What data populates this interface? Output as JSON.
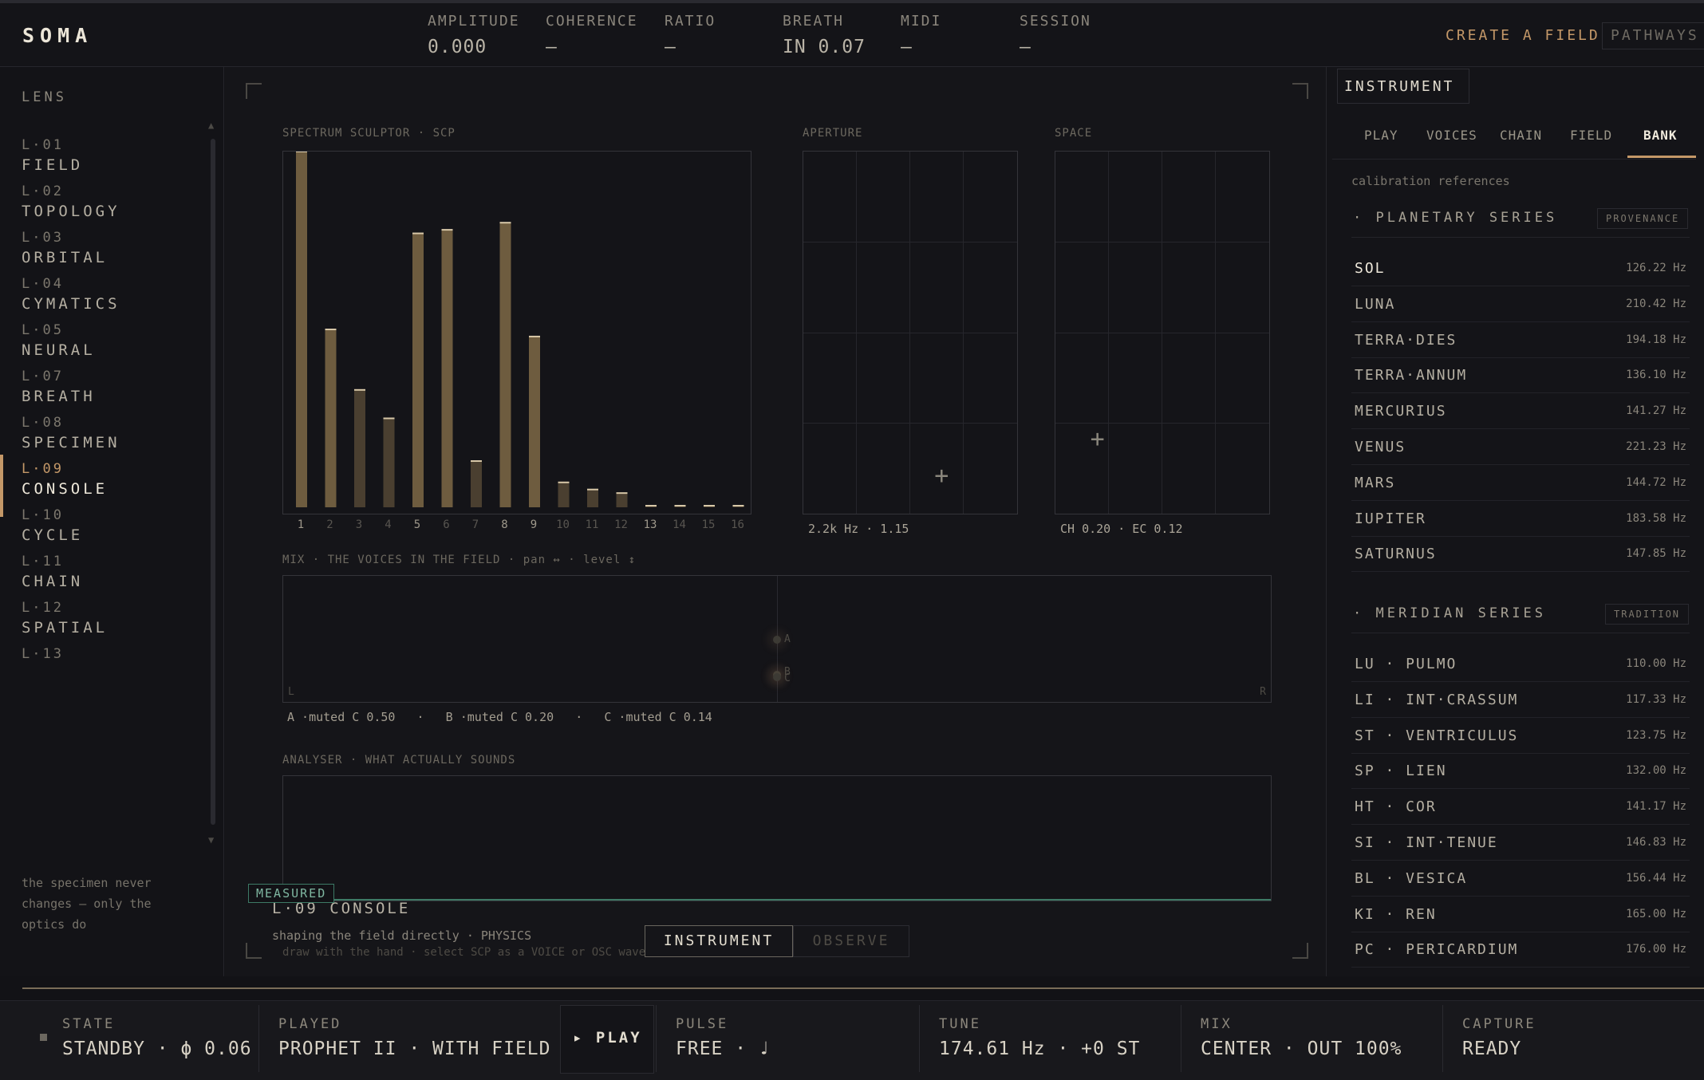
{
  "app": {
    "logo": "SOMA",
    "metrics": [
      {
        "label": "AMPLITUDE",
        "value": "0.000"
      },
      {
        "label": "COHERENCE",
        "value": "—"
      },
      {
        "label": "RATIO",
        "value": "—"
      },
      {
        "label": "BREATH",
        "value": "IN 0.07"
      },
      {
        "label": "MIDI",
        "value": "—"
      },
      {
        "label": "SESSION",
        "value": "—"
      }
    ],
    "create_field": "CREATE A FIELD",
    "pathways": "PATHWAYS"
  },
  "sidebar": {
    "title": "LENS",
    "items": [
      {
        "num": "L·01",
        "name": "FIELD"
      },
      {
        "num": "L·02",
        "name": "TOPOLOGY"
      },
      {
        "num": "L·03",
        "name": "ORBITAL"
      },
      {
        "num": "L·04",
        "name": "CYMATICS"
      },
      {
        "num": "L·05",
        "name": "NEURAL"
      },
      {
        "num": "L·07",
        "name": "BREATH"
      },
      {
        "num": "L·08",
        "name": "SPECIMEN"
      },
      {
        "num": "L·09",
        "name": "CONSOLE"
      },
      {
        "num": "L·10",
        "name": "CYCLE"
      },
      {
        "num": "L·11",
        "name": "CHAIN"
      },
      {
        "num": "L·12",
        "name": "SPATIAL"
      },
      {
        "num": "L·13",
        "name": ""
      }
    ],
    "active_index": 7,
    "note": "the specimen never changes — only the optics do"
  },
  "stage": {
    "spectrum_label": "SPECTRUM SCULPTOR · SCP",
    "aperture_label": "APERTURE",
    "space_label": "SPACE",
    "aperture_readout": "2.2k Hz · 1.15",
    "space_readout": "CH 0.20 · EC 0.12",
    "mix_label": "MIX · THE VOICES IN THE FIELD · pan ↔ · level ↕",
    "mix_axis_left": "L",
    "mix_axis_right": "R",
    "mix_voices": [
      "A",
      "B",
      "C"
    ],
    "mix_legend": "A ·muted C 0.50   ·   B ·muted C 0.20   ·   C ·muted C 0.14",
    "analyser_label": "ANALYSER · WHAT ACTUALLY SOUNDS",
    "measured_badge": "MEASURED",
    "title": "L·09  CONSOLE",
    "subtitle": "shaping the field directly · PHYSICS",
    "hint": "draw with the hand · select SCP as a VOICE or OSC waveform to hear it",
    "btn_instrument": "INSTRUMENT",
    "btn_observe": "OBSERVE"
  },
  "chart_data": [
    {
      "type": "bar",
      "title": "SPECTRUM SCULPTOR · SCP",
      "categories": [
        "1",
        "2",
        "3",
        "4",
        "5",
        "6",
        "7",
        "8",
        "9",
        "10",
        "11",
        "12",
        "13",
        "14",
        "15",
        "16"
      ],
      "values": [
        1.0,
        0.5,
        0.33,
        0.25,
        0.77,
        0.78,
        0.13,
        0.8,
        0.48,
        0.07,
        0.05,
        0.04,
        0.0,
        0.0,
        0.0,
        0.0
      ],
      "ylim": [
        0,
        1
      ],
      "highlighted_ticks": [
        "1",
        "5",
        "8",
        "9",
        "13"
      ],
      "bar_color": "#6b5a3e"
    },
    {
      "type": "scatter",
      "title": "APERTURE",
      "point": {
        "x": 0.65,
        "y": 0.1
      },
      "readout": "2.2k Hz · 1.15"
    },
    {
      "type": "scatter",
      "title": "SPACE",
      "point": {
        "x": 0.2,
        "y": 0.2
      },
      "readout": "CH 0.20 · EC 0.12"
    }
  ],
  "right_panel": {
    "header": "INSTRUMENT",
    "tabs": [
      "PLAY",
      "VOICES",
      "CHAIN",
      "FIELD",
      "BANK"
    ],
    "active_tab": "BANK",
    "caption": "calibration references",
    "series": [
      {
        "title": "· PLANETARY SERIES",
        "tag": "PROVENANCE",
        "rows": [
          {
            "name": "SOL",
            "value": "126.22 Hz"
          },
          {
            "name": "LUNA",
            "value": "210.42 Hz"
          },
          {
            "name": "TERRA·DIES",
            "value": "194.18 Hz"
          },
          {
            "name": "TERRA·ANNUM",
            "value": "136.10 Hz"
          },
          {
            "name": "MERCURIUS",
            "value": "141.27 Hz"
          },
          {
            "name": "VENUS",
            "value": "221.23 Hz"
          },
          {
            "name": "MARS",
            "value": "144.72 Hz"
          },
          {
            "name": "IUPITER",
            "value": "183.58 Hz"
          },
          {
            "name": "SATURNUS",
            "value": "147.85 Hz"
          }
        ]
      },
      {
        "title": "· MERIDIAN SERIES",
        "tag": "TRADITION",
        "rows": [
          {
            "name": "LU · PULMO",
            "value": "110.00 Hz"
          },
          {
            "name": "LI · INT·CRASSUM",
            "value": "117.33 Hz"
          },
          {
            "name": "ST · VENTRICULUS",
            "value": "123.75 Hz"
          },
          {
            "name": "SP · LIEN",
            "value": "132.00 Hz"
          },
          {
            "name": "HT · COR",
            "value": "141.17 Hz"
          },
          {
            "name": "SI · INT·TENUE",
            "value": "146.83 Hz"
          },
          {
            "name": "BL · VESICA",
            "value": "156.44 Hz"
          },
          {
            "name": "KI · REN",
            "value": "165.00 Hz"
          },
          {
            "name": "PC · PERICARDIUM",
            "value": "176.00 Hz"
          }
        ]
      }
    ]
  },
  "bottom": {
    "state": {
      "label": "STATE",
      "value": "STANDBY · ϕ 0.06"
    },
    "played": {
      "label": "PLAYED",
      "value": "PROPHET II · WITH FIELD"
    },
    "play_button": "▸ PLAY",
    "pulse": {
      "label": "PULSE",
      "value": "FREE · ♩"
    },
    "tune": {
      "label": "TUNE",
      "value": "174.61 Hz · +0 ST"
    },
    "mix": {
      "label": "MIX",
      "value": "CENTER · OUT 100%"
    },
    "capture": {
      "label": "CAPTURE",
      "value": "READY"
    }
  },
  "colors": {
    "accent": "#c49868",
    "measured": "#3d7a66",
    "background": "#121216"
  }
}
